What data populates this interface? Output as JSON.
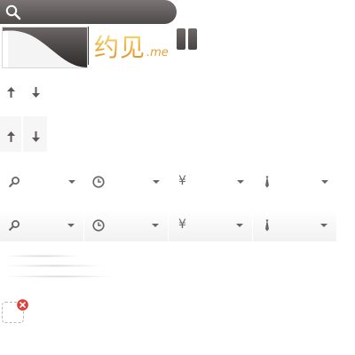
{
  "search": {
    "icon": "search-icon"
  },
  "logo": {
    "main": "约见",
    "suffix": ".me"
  },
  "pause": {
    "icon": "pause-icon"
  },
  "sort_controls": [
    {
      "up_icon": "arrow-up-icon",
      "down_icon": "arrow-down-icon",
      "style": "plain"
    },
    {
      "up_icon": "arrow-up-icon",
      "down_icon": "arrow-down-icon",
      "style": "shaded"
    }
  ],
  "filters": [
    {
      "style": "plain",
      "items": [
        {
          "icon": "location-pin-icon"
        },
        {
          "icon": "clock-icon"
        },
        {
          "icon": "yen-icon",
          "glyph": "¥"
        },
        {
          "icon": "tie-icon"
        }
      ]
    },
    {
      "style": "shaded",
      "items": [
        {
          "icon": "location-pin-icon"
        },
        {
          "icon": "clock-icon"
        },
        {
          "icon": "yen-icon",
          "glyph": "¥"
        },
        {
          "icon": "tie-icon"
        }
      ]
    }
  ],
  "colors": {
    "icon_gray": "#6a6464",
    "dark_pill": "#5a5454",
    "logo_gold": "#f0b43a",
    "delete_red": "#e2423b"
  }
}
